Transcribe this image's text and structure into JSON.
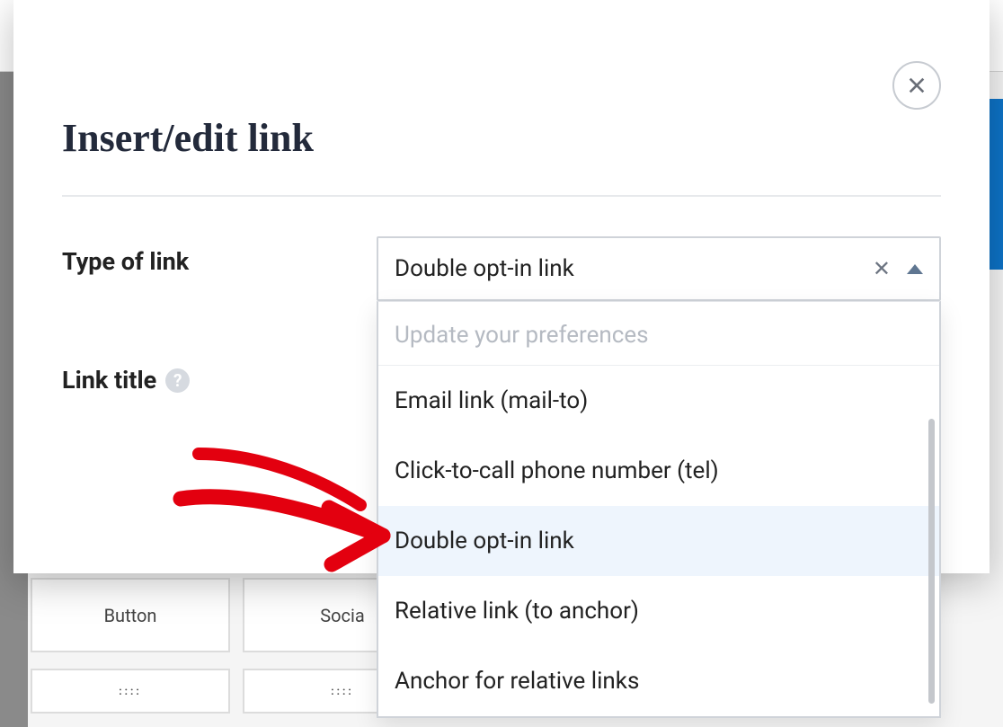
{
  "modal": {
    "title": "Insert/edit link",
    "labels": {
      "type_of_link": "Type of link",
      "link_title": "Link title"
    },
    "select": {
      "value": "Double opt-in link",
      "search_placeholder": "Update your preferences",
      "options": [
        "Email link (mail-to)",
        "Click-to-call phone number (tel)",
        "Double opt-in link",
        "Relative link (to anchor)",
        "Anchor for relative links"
      ],
      "selected_index": 2
    }
  },
  "background": {
    "tiles_row1": [
      "Button",
      "Socia"
    ],
    "drag_handle_glyph": "::::"
  }
}
